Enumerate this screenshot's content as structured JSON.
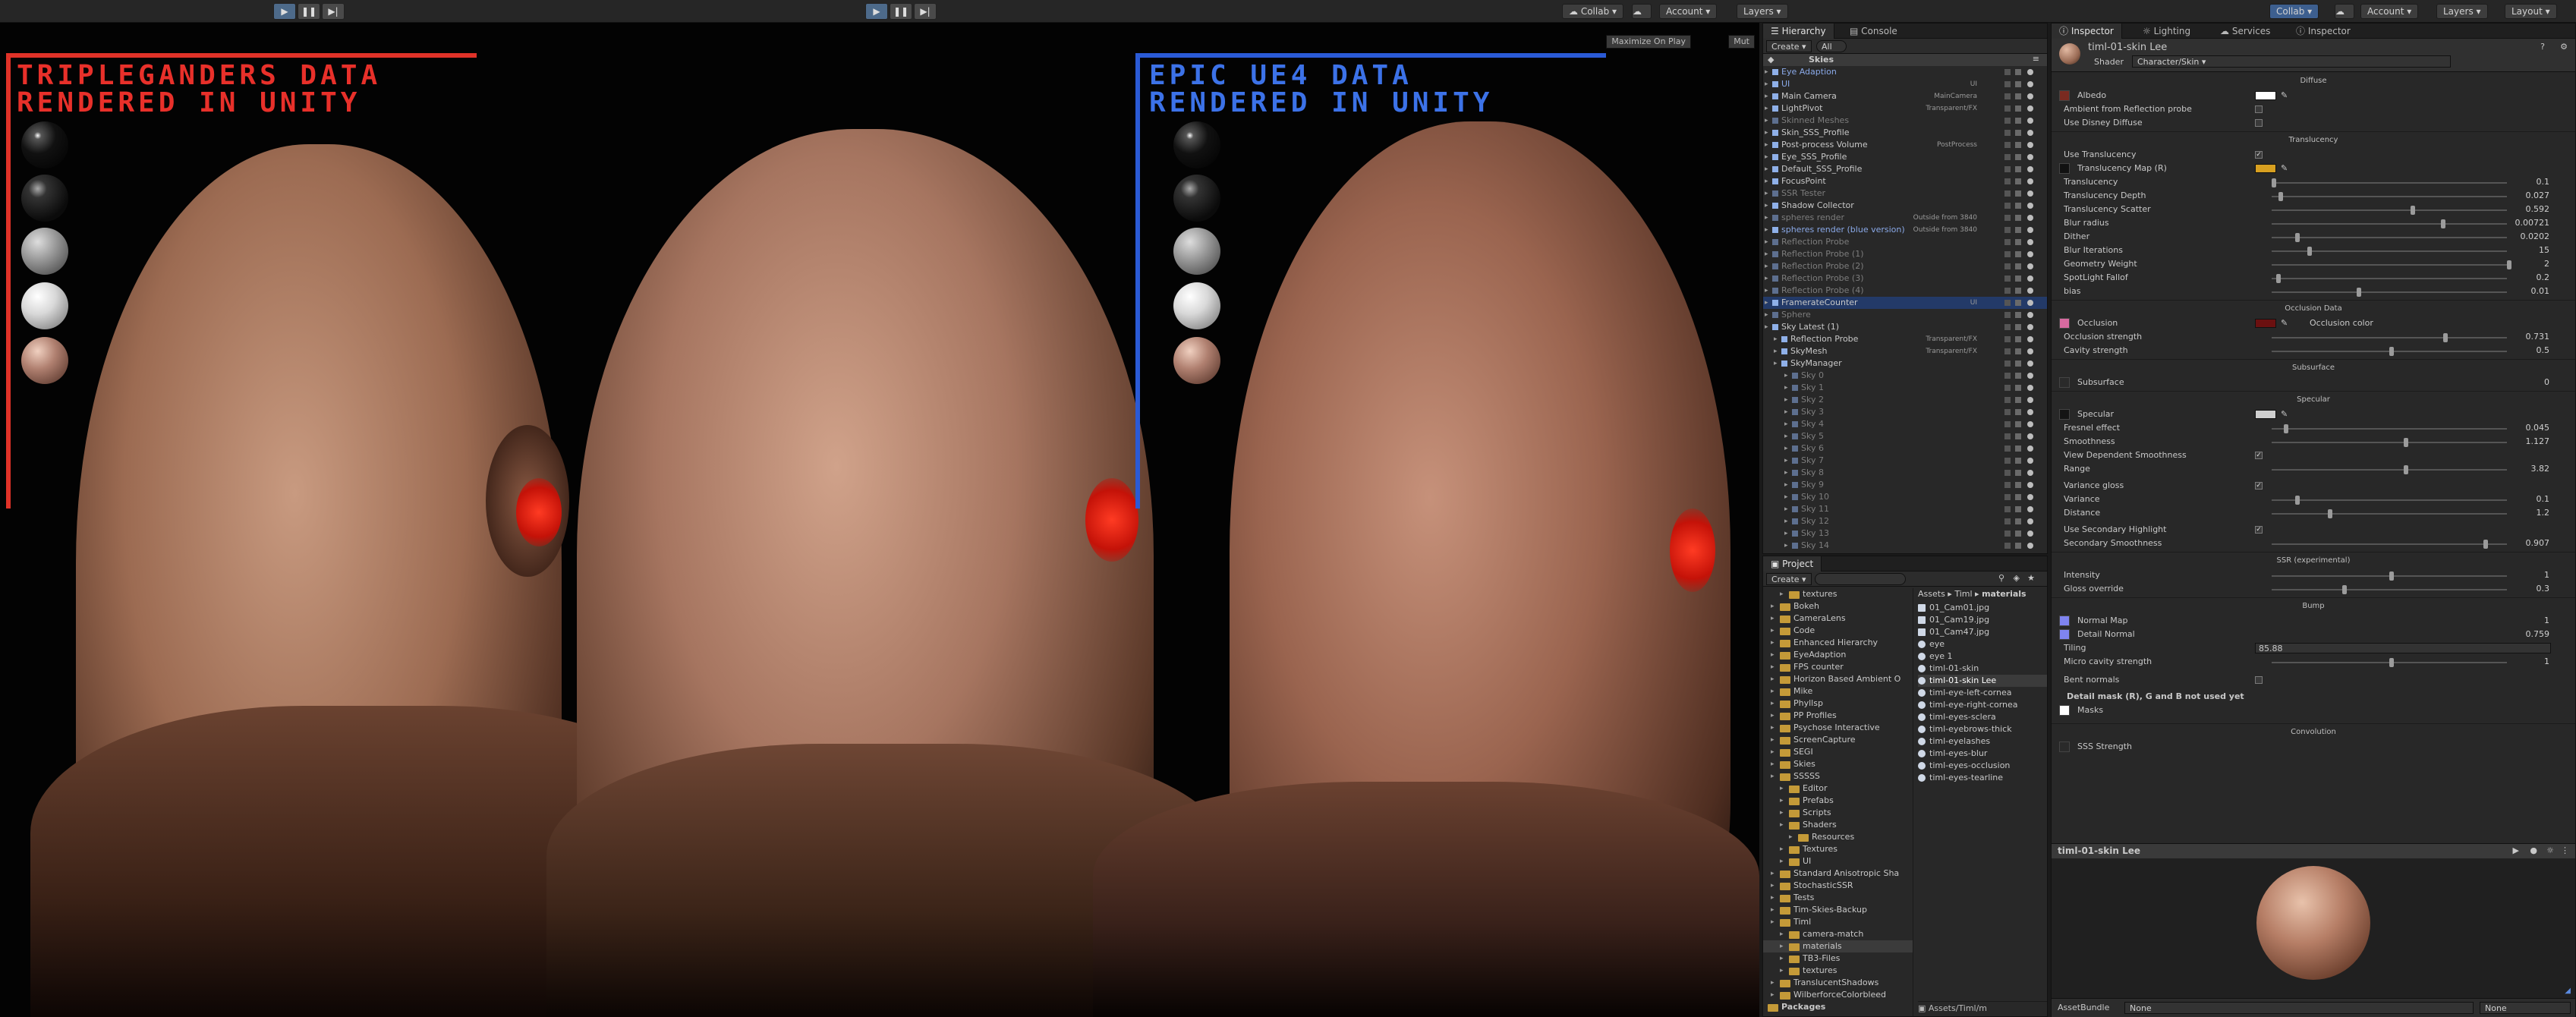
{
  "toolbar": {
    "collab": "Collab",
    "account": "Account",
    "layers": "Layers",
    "layout": "Layout",
    "collab_right": "Collab",
    "account_right": "Account",
    "layers_right": "Layers",
    "layout_right": "Layout"
  },
  "game_view": {
    "maximize_label": "Maximize On Play",
    "mute_label": "Mut",
    "left_title_1": "Tripleganders data",
    "left_title_2": "rendered in unity",
    "right_title_1": "Epic UE4 data",
    "right_title_2": "rendered in unity"
  },
  "hierarchy": {
    "tab": "Hierarchy",
    "console_tab": "Console",
    "create": "Create",
    "search_all": "All",
    "scene": "Skies",
    "rows": [
      {
        "t": "Eye Adaption",
        "s": "blu",
        "tag": ""
      },
      {
        "t": "UI",
        "s": "blu",
        "tag": "UI"
      },
      {
        "t": "Main Camera",
        "s": "",
        "tag": "MainCamera"
      },
      {
        "t": "LightPivot",
        "s": "",
        "tag": "Transparent/FX"
      },
      {
        "t": "Skinned Meshes",
        "s": "dim",
        "tag": ""
      },
      {
        "t": "Skin_SSS_Profile",
        "s": "",
        "tag": ""
      },
      {
        "t": "Post-process Volume",
        "s": "",
        "tag": "PostProcess"
      },
      {
        "t": "Eye_SSS_Profile",
        "s": "",
        "tag": ""
      },
      {
        "t": "Default_SSS_Profile",
        "s": "",
        "tag": ""
      },
      {
        "t": "FocusPoint",
        "s": "",
        "tag": ""
      },
      {
        "t": "SSR Tester",
        "s": "dim",
        "tag": ""
      },
      {
        "t": "Shadow Collector",
        "s": "",
        "tag": ""
      },
      {
        "t": "spheres render",
        "s": "dim",
        "tag": "Outside from 3840"
      },
      {
        "t": "spheres render (blue version)",
        "s": "blu",
        "tag": "Outside from 3840"
      },
      {
        "t": "Reflection Probe",
        "s": "dim",
        "tag": ""
      },
      {
        "t": "Reflection Probe (1)",
        "s": "dim",
        "tag": ""
      },
      {
        "t": "Reflection Probe (2)",
        "s": "dim",
        "tag": ""
      },
      {
        "t": "Reflection Probe (3)",
        "s": "dim",
        "tag": ""
      },
      {
        "t": "Reflection Probe (4)",
        "s": "dim",
        "tag": ""
      },
      {
        "t": "FramerateCounter",
        "s": "sel",
        "tag": "UI"
      },
      {
        "t": "Sphere",
        "s": "dim",
        "tag": ""
      },
      {
        "t": "Sky Latest (1)",
        "s": "",
        "tag": ""
      },
      {
        "t": "Reflection Probe",
        "s": "",
        "tag": "Transparent/FX"
      },
      {
        "t": "SkyMesh",
        "s": "",
        "tag": "Transparent/FX"
      },
      {
        "t": "SkyManager",
        "s": "",
        "tag": ""
      },
      {
        "t": "Sky 0",
        "s": "dim",
        "tag": ""
      },
      {
        "t": "Sky 1",
        "s": "dim",
        "tag": ""
      },
      {
        "t": "Sky 2",
        "s": "dim",
        "tag": ""
      },
      {
        "t": "Sky 3",
        "s": "dim",
        "tag": ""
      },
      {
        "t": "Sky 4",
        "s": "dim",
        "tag": ""
      },
      {
        "t": "Sky 5",
        "s": "dim",
        "tag": ""
      },
      {
        "t": "Sky 6",
        "s": "dim",
        "tag": ""
      },
      {
        "t": "Sky 7",
        "s": "dim",
        "tag": ""
      },
      {
        "t": "Sky 8",
        "s": "dim",
        "tag": ""
      },
      {
        "t": "Sky 9",
        "s": "dim",
        "tag": ""
      },
      {
        "t": "Sky 10",
        "s": "dim",
        "tag": ""
      },
      {
        "t": "Sky 11",
        "s": "dim",
        "tag": ""
      },
      {
        "t": "Sky 12",
        "s": "dim",
        "tag": ""
      },
      {
        "t": "Sky 13",
        "s": "dim",
        "tag": ""
      },
      {
        "t": "Sky 14",
        "s": "dim",
        "tag": ""
      }
    ]
  },
  "project": {
    "tab": "Project",
    "create": "Create",
    "breadcrumb_1": "Assets",
    "breadcrumb_2": "Timl",
    "breadcrumb_3": "materials",
    "bottom_path": "Assets/Timl/m",
    "tree": [
      "textures",
      "Bokeh",
      "CameraLens",
      "Code",
      "Enhanced Hierarchy",
      "EyeAdaption",
      "FPS counter",
      "Horizon Based Ambient O",
      "Mike",
      "Phyllsp",
      "PP Profiles",
      "Psychose Interactive",
      "ScreenCapture",
      "SEGI",
      "Skies",
      "SSSSS",
      "Editor",
      "Prefabs",
      "Scripts",
      "Shaders",
      "Resources",
      "Textures",
      "UI",
      "Standard Anisotropic Sha",
      "StochasticSSR",
      "Tests",
      "Tim-Skies-Backup",
      "Timl",
      "camera-match",
      "materials",
      "TB3-Files",
      "textures",
      "TranslucentShadows",
      "WilberforceColorbleed",
      "Packages"
    ],
    "files": [
      "01_Cam01.jpg",
      "01_Cam19.jpg",
      "01_Cam47.jpg",
      "eye",
      "eye 1",
      "timl-01-skin",
      "timl-01-skin Lee",
      "timl-eye-left-cornea",
      "timl-eye-right-cornea",
      "timl-eyes-sclera",
      "timl-eyebrows-thick",
      "timl-eyelashes",
      "timl-eyes-blur",
      "timl-eyes-occlusion",
      "timl-eyes-tearline"
    ]
  },
  "inspector": {
    "tab": "Inspector",
    "lighting_tab": "Lighting",
    "services_tab": "Services",
    "inspector2_tab": "Inspector",
    "material_name": "timl-01-skin Lee",
    "shader_label": "Shader",
    "shader_value": "Character/Skin",
    "diffuse": "Diffuse",
    "albedo": "Albedo",
    "ambient_reflection": "Ambient from Reflection probe",
    "use_disney": "Use Disney Diffuse",
    "translucency_header": "Translucency",
    "use_translucency": "Use Translucency",
    "translucency_map": "Translucency Map (R)",
    "translucency": "Translucency",
    "translucency_val": "0.1",
    "depth": "Translucency Depth",
    "depth_val": "0.027",
    "scatter": "Translucency Scatter",
    "scatter_val": "0.592",
    "blur_radius": "Blur radius",
    "blur_radius_val": "0.00721",
    "dither": "Dither",
    "dither_val": "0.0202",
    "blur_iterations": "Blur Iterations",
    "blur_iterations_val": "15",
    "geometry_weight": "Geometry Weight",
    "geometry_weight_val": "2",
    "spotlight": "SpotLight Fallof",
    "spotlight_val": "0.2",
    "bias": "bias",
    "bias_val": "0.01",
    "occlusion_header": "Occlusion Data",
    "occlusion": "Occlusion",
    "occlusion_color": "Occlusion color",
    "occlusion_strength": "Occlusion strength",
    "occlusion_strength_val": "0.731",
    "cavity": "Cavity strength",
    "cavity_val": "0.5",
    "subsurface_header": "Subsurface",
    "subsurface": "Subsurface",
    "subsurface_val": "0",
    "specular_header": "Specular",
    "specular": "Specular",
    "fresnel": "Fresnel effect",
    "fresnel_val": "0.045",
    "smoothness": "Smoothness",
    "smoothness_val": "1.127",
    "view_dep": "View Dependent Smoothness",
    "range": "Range",
    "range_val": "3.82",
    "variance_gloss": "Variance gloss",
    "variance": "Variance",
    "variance_val": "0.1",
    "distance": "Distance",
    "distance_val": "1.2",
    "secondary_hl": "Use Secondary Highlight",
    "secondary_smooth": "Secondary Smoothness",
    "secondary_smooth_val": "0.907",
    "ssr_header": "SSR (experimental)",
    "intensity": "Intensity",
    "intensity_val": "1",
    "gloss_override": "Gloss override",
    "gloss_override_val": "0.3",
    "bump_header": "Bump",
    "normal_map": "Normal Map",
    "normal_val": "1",
    "detail_normal": "Detail Normal",
    "detail_normal_val": "0.759",
    "tiling": "Tiling",
    "tiling_val": "85.88",
    "micro_cavity": "Micro cavity strength",
    "micro_cavity_val": "1",
    "bent_normals": "Bent normals",
    "detail_mask": "Detail mask (R), G and B not used yet",
    "masks": "Masks",
    "convolution_header": "Convolution",
    "sss_strength": "SSS Strength",
    "preview_title": "timl-01-skin Lee",
    "assetbundle": "AssetBundle",
    "none1": "None",
    "none2": "None"
  },
  "colors": {
    "accent_red": "#e03228",
    "accent_blue": "#2a5ad6",
    "selection": "#233a68",
    "albedo_color": "#ffffff",
    "occlusion_color_val": "#6b1010"
  }
}
